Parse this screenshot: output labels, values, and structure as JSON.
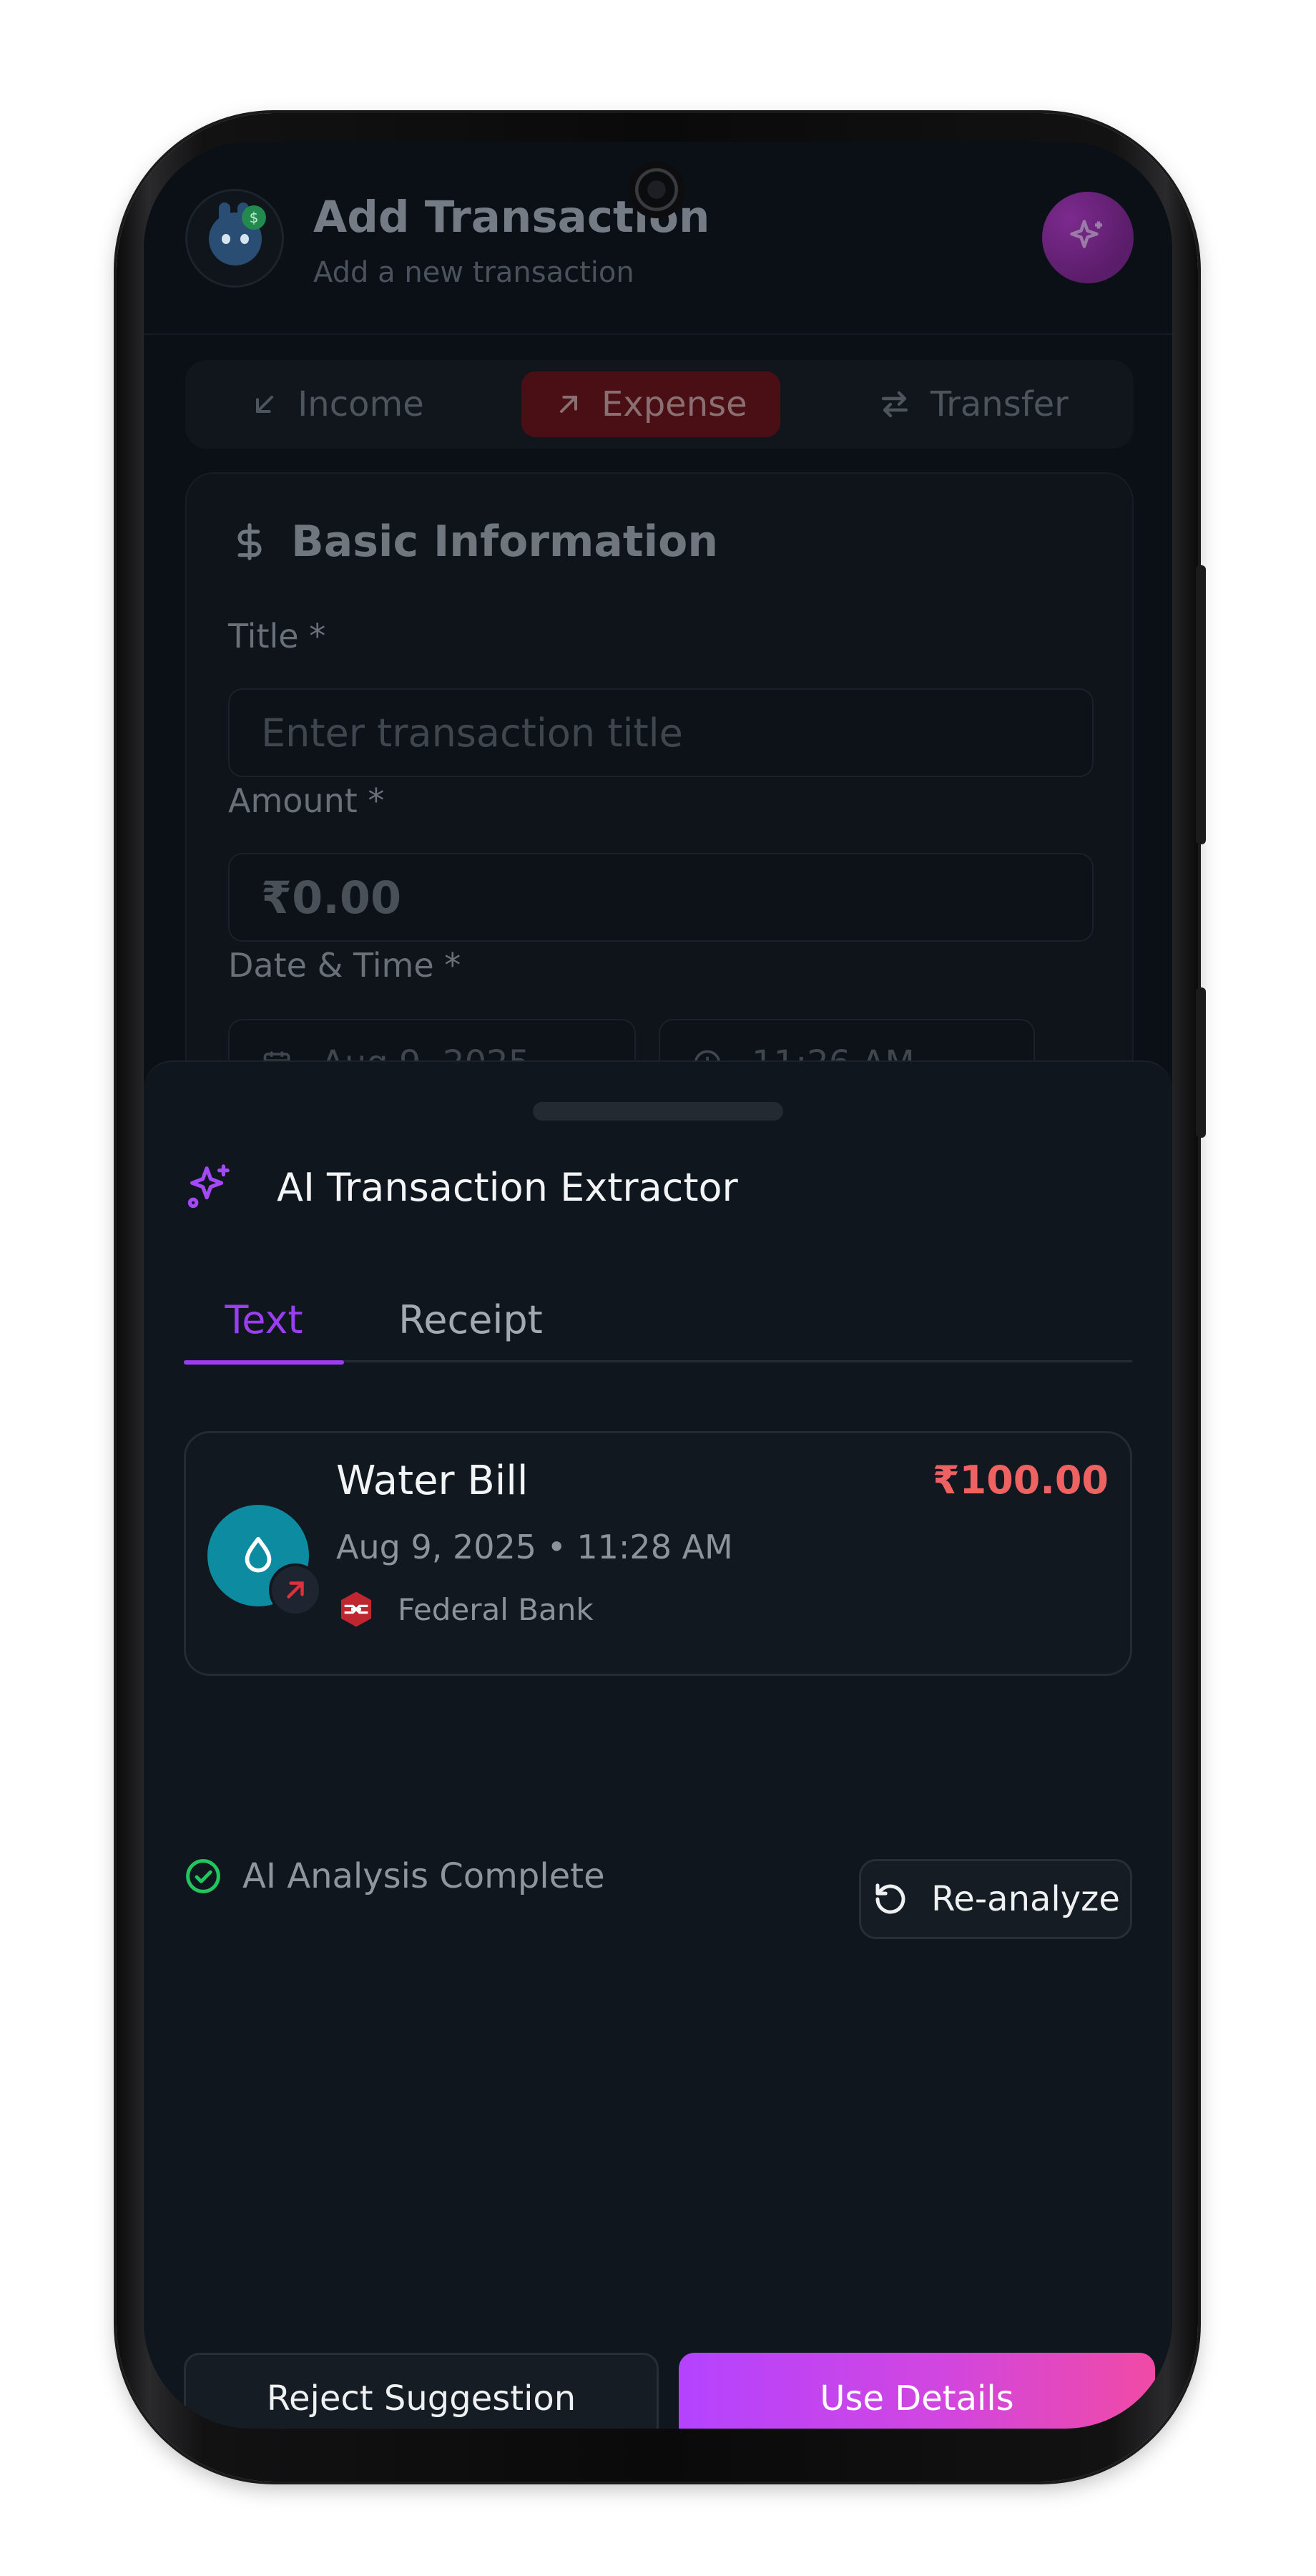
{
  "header": {
    "title": "Add Transaction",
    "subtitle": "Add a new transaction"
  },
  "type_tabs": [
    {
      "label": "Income",
      "icon": "arrow-down-left-icon",
      "active": false
    },
    {
      "label": "Expense",
      "icon": "arrow-up-right-icon",
      "active": true
    },
    {
      "label": "Transfer",
      "icon": "arrows-swap-icon",
      "active": false
    }
  ],
  "basic_info": {
    "section_title": "Basic Information",
    "title_label": "Title *",
    "title_placeholder": "Enter transaction title",
    "amount_label": "Amount *",
    "amount_value": "₹0.00",
    "datetime_label": "Date & Time *",
    "date_value": "Aug 9, 2025",
    "time_value": "11:26 AM"
  },
  "sheet": {
    "title": "AI Transaction Extractor",
    "tabs": [
      {
        "label": "Text",
        "active": true
      },
      {
        "label": "Receipt",
        "active": false
      }
    ],
    "transaction": {
      "name": "Water Bill",
      "amount": "₹100.00",
      "datetime": "Aug 9, 2025 • 11:28 AM",
      "account": "Federal Bank",
      "category_icon": "water-drop-icon"
    },
    "status_text": "AI Analysis Complete",
    "reanalyze_label": "Re-analyze",
    "reject_label": "Reject Suggestion",
    "use_label": "Use Details"
  },
  "colors": {
    "accent": "#9b3df2",
    "expense_red": "#f06262",
    "success_green": "#22c55e",
    "water_teal": "#0d8ba0",
    "gradient_start": "#b443ff",
    "gradient_end": "#f04aa5"
  }
}
